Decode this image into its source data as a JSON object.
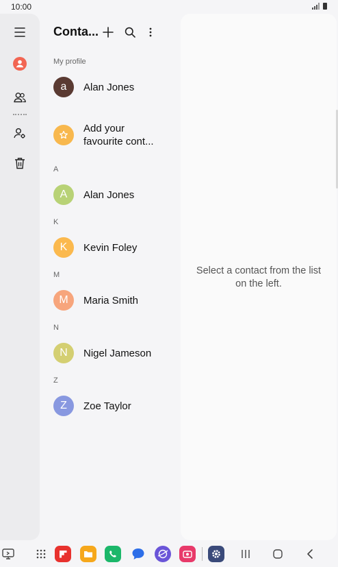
{
  "status_bar": {
    "time": "10:00"
  },
  "header": {
    "title": "Conta..."
  },
  "rail": {
    "items": [
      {
        "icon": "menu-icon"
      },
      {
        "icon": "profile-icon"
      },
      {
        "icon": "contacts-icon"
      },
      {
        "icon": "manage-contacts-icon"
      },
      {
        "icon": "trash-icon"
      }
    ]
  },
  "sections": {
    "my_profile": "My profile",
    "a": "A",
    "k": "K",
    "m": "M",
    "n": "N",
    "z": "Z"
  },
  "contacts": [
    {
      "initial": "a",
      "name": "Alan Jones",
      "color": "#5a3a32"
    },
    {
      "initial": "☆",
      "name": "Add your favourite cont...",
      "color": "#f8b84e"
    },
    {
      "initial": "A",
      "name": "Alan Jones",
      "color": "#b8d276"
    },
    {
      "initial": "K",
      "name": "Kevin Foley",
      "color": "#fbb94e"
    },
    {
      "initial": "M",
      "name": "Maria Smith",
      "color": "#f7a57c"
    },
    {
      "initial": "N",
      "name": "Nigel Jameson",
      "color": "#d4cf72"
    },
    {
      "initial": "Z",
      "name": "Zoe Taylor",
      "color": "#8898e0"
    }
  ],
  "detail": {
    "message": "Select a contact from the list on the left."
  },
  "colors": {
    "accent": "#f26552",
    "rail_bg": "#ececee",
    "detail_bg": "#fafafa"
  },
  "taskbar": {
    "apps": [
      {
        "icon": "recent-apps-icon",
        "color": "#555555"
      },
      {
        "icon": "app-drawer-icon",
        "color": "#555555"
      },
      {
        "icon": "flipboard-icon",
        "color": "#e8322e"
      },
      {
        "icon": "files-icon",
        "color": "#f6a81c"
      },
      {
        "icon": "phone-icon",
        "color": "#1cb76a"
      },
      {
        "icon": "messages-icon",
        "color": "#2d6ee8"
      },
      {
        "icon": "internet-icon",
        "color": "#6a55d8"
      },
      {
        "icon": "screen-recorder-icon",
        "color": "#e83a6a"
      },
      {
        "icon": "settings-icon",
        "color": "#3a4a7a"
      }
    ],
    "nav": [
      {
        "icon": "recents-nav-icon"
      },
      {
        "icon": "home-nav-icon"
      },
      {
        "icon": "back-nav-icon"
      }
    ]
  }
}
